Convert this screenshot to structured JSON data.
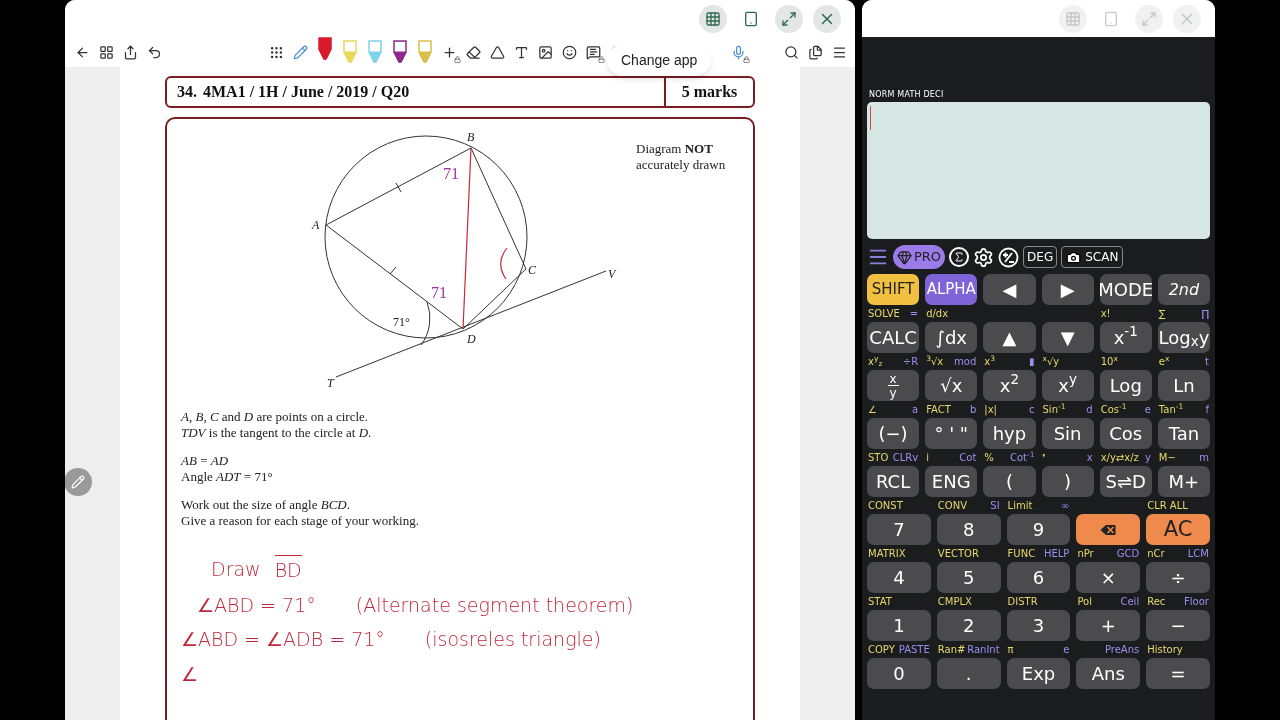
{
  "left_window": {
    "active": true,
    "toolbar": [
      {
        "kind": "back"
      },
      {
        "kind": "grid"
      },
      {
        "kind": "share"
      },
      {
        "kind": "undo"
      },
      {
        "kind": "spacer"
      },
      {
        "kind": "apps"
      },
      {
        "kind": "pencil"
      },
      {
        "kind": "pen",
        "color": "#d81b2b",
        "selected": true
      },
      {
        "kind": "pen",
        "color": "#e8d85a",
        "selected": false
      },
      {
        "kind": "pen",
        "color": "#7fd3e6",
        "selected": false
      },
      {
        "kind": "pen",
        "color": "#8a2a8c",
        "selected": false
      },
      {
        "kind": "pen",
        "color": "#d9c04a",
        "selected": false
      },
      {
        "kind": "add",
        "locked": true
      },
      {
        "kind": "eraser"
      },
      {
        "kind": "lasso"
      },
      {
        "kind": "text"
      },
      {
        "kind": "image"
      },
      {
        "kind": "sticker"
      },
      {
        "kind": "comment",
        "locked": true
      },
      {
        "kind": "bubble"
      },
      {
        "kind": "spacer"
      },
      {
        "kind": "mic",
        "locked": true
      },
      {
        "kind": "gap"
      },
      {
        "kind": "search"
      },
      {
        "kind": "pages"
      },
      {
        "kind": "menu"
      }
    ],
    "tooltip": "Change app",
    "question": {
      "number": "34.",
      "code": "4MA1 / 1H / June / 2019 / Q20",
      "marks": "5 marks",
      "diagram": {
        "note": [
          "Diagram **NOT**",
          "accurately drawn"
        ],
        "points": [
          "A",
          "B",
          "C",
          "D",
          "T",
          "V"
        ],
        "angle": "71°",
        "annotations": [
          "71",
          "71"
        ]
      },
      "text_groups": [
        [
          "*A*, *B*, *C* and *D* are points on a circle.",
          "*TDV* is the tangent to the circle at *D*."
        ],
        [
          "*AB* = *AD*",
          "Angle *ADT* = 71°"
        ],
        [
          "Work out the size of angle *BCD*.",
          "Give a reason for each stage of your working."
        ]
      ],
      "working": [
        {
          "kind": "construct",
          "text": "Draw",
          "segment": "BD"
        },
        {
          "kind": "step",
          "statement": "∠ABD = 71°",
          "reason": "(Alternate segment theorem)"
        },
        {
          "kind": "step",
          "statement": "∠ABD = ∠ADB = 71°",
          "reason": "(isosreles triangle)"
        },
        {
          "kind": "partial",
          "statement": "∠"
        }
      ]
    }
  },
  "right_window": {
    "active": false,
    "status": "NORM MATH DECI",
    "toolbar": [
      {
        "kind": "menu"
      },
      {
        "kind": "pro",
        "label": "PRO"
      },
      {
        "kind": "sum"
      },
      {
        "kind": "settings"
      },
      {
        "kind": "sign"
      },
      {
        "kind": "box",
        "label": "DEG"
      },
      {
        "kind": "scan",
        "label": "SCAN"
      }
    ],
    "rows": [
      [
        {
          "label": "SHIFT",
          "kind": "shift"
        },
        {
          "label": "ALPHA",
          "kind": "alpha"
        },
        {
          "label": "◀",
          "kind": "plain"
        },
        {
          "label": "▶",
          "kind": "plain"
        },
        {
          "label": "MODE",
          "kind": "plain"
        },
        {
          "label": "2nd",
          "kind": "italic"
        }
      ],
      [
        {
          "label": "CALC",
          "kind": "plain",
          "shift": "SOLVE",
          "alpha": "="
        },
        {
          "label": "∫dx",
          "kind": "plain",
          "shift": "d/dx"
        },
        {
          "label": "▲",
          "kind": "plain"
        },
        {
          "label": "▼",
          "kind": "plain"
        },
        {
          "label": "x$^{-1}$",
          "kind": "plain",
          "shift": "x!"
        },
        {
          "label": "Log$_{x}$y",
          "kind": "plain",
          "shift": "∑",
          "alpha": "∏"
        }
      ],
      [
        {
          "kind": "fraction",
          "num": "x",
          "den": "y",
          "shift": "x$^{y}$$_{z}$",
          "alpha": "÷R"
        },
        {
          "label": "√x",
          "kind": "plain",
          "shift": "$^{3}$√x",
          "alpha": "mod"
        },
        {
          "label": "x$^{2}$",
          "kind": "plain",
          "shift": "x$^{3}$",
          "alpha": "▮"
        },
        {
          "label": "x$^{y}$",
          "kind": "plain",
          "shift": "$^{x}$√y"
        },
        {
          "label": "Log",
          "kind": "plain",
          "shift": "10$^{x}$"
        },
        {
          "label": "Ln",
          "kind": "plain",
          "shift": "e$^{x}$",
          "alpha": "t"
        }
      ],
      [
        {
          "label": "(−)",
          "kind": "plain",
          "shift": "∠",
          "alpha": "a"
        },
        {
          "label": "° ' \"",
          "kind": "plain",
          "shift": "FACT",
          "alpha": "b"
        },
        {
          "label": "hyp",
          "kind": "plain",
          "shift": "|x|",
          "alpha": "c"
        },
        {
          "label": "Sin",
          "kind": "plain",
          "shift": "Sin$^{-1}$",
          "alpha": "d"
        },
        {
          "label": "Cos",
          "kind": "plain",
          "shift": "Cos$^{-1}$",
          "alpha": "e"
        },
        {
          "label": "Tan",
          "kind": "plain",
          "shift": "Tan$^{-1}$",
          "alpha": "f"
        }
      ],
      [
        {
          "label": "RCL",
          "kind": "plain",
          "shift": "STO",
          "alpha": "CLRv"
        },
        {
          "label": "ENG",
          "kind": "plain",
          "shift": "i",
          "alpha": "Cot"
        },
        {
          "label": "(",
          "kind": "plain",
          "shift": "%",
          "alpha": "Cot$^{-1}$"
        },
        {
          "label": ")",
          "kind": "plain",
          "shift": "❜",
          "alpha": "x"
        },
        {
          "label": "S⇌D",
          "kind": "plain",
          "shift": "x/y⇄x/z",
          "alpha": "y"
        },
        {
          "label": "M+",
          "kind": "plain",
          "shift": "M−",
          "alpha": "m"
        }
      ],
      [
        {
          "label": "7",
          "kind": "plain",
          "shift": "CONST"
        },
        {
          "label": "8",
          "kind": "plain",
          "shift": "CONV",
          "alpha": "SI"
        },
        {
          "label": "9",
          "kind": "plain",
          "shift": "Limit",
          "alpha": "∞"
        },
        {
          "kind": "delete"
        },
        {
          "label": "AC",
          "kind": "orange",
          "shift": "CLR ALL"
        }
      ],
      [
        {
          "label": "4",
          "kind": "plain",
          "shift": "MATRIX"
        },
        {
          "label": "5",
          "kind": "plain",
          "shift": "VECTOR"
        },
        {
          "label": "6",
          "kind": "plain",
          "shift": "FUNC",
          "alpha": "HELP"
        },
        {
          "label": "×",
          "kind": "plain",
          "shift": "nPr",
          "alpha": "GCD"
        },
        {
          "label": "÷",
          "kind": "plain",
          "shift": "nCr",
          "alpha": "LCM"
        }
      ],
      [
        {
          "label": "1",
          "kind": "plain",
          "shift": "STAT"
        },
        {
          "label": "2",
          "kind": "plain",
          "shift": "CMPLX"
        },
        {
          "label": "3",
          "kind": "plain",
          "shift": "DISTR"
        },
        {
          "label": "+",
          "kind": "plain",
          "shift": "Pol",
          "alpha": "Ceil"
        },
        {
          "label": "−",
          "kind": "plain",
          "shift": "Rec",
          "alpha": "Floor"
        }
      ],
      [
        {
          "label": "0",
          "kind": "plain",
          "shift": "COPY",
          "alpha": "PASTE"
        },
        {
          "label": ".",
          "kind": "plain",
          "shift": "Ran#",
          "alpha": "RanInt"
        },
        {
          "label": "Exp",
          "kind": "plain",
          "shift": "π",
          "alpha": "e"
        },
        {
          "label": "Ans",
          "kind": "plain",
          "alpha": "PreAns"
        },
        {
          "label": "=",
          "kind": "plain",
          "shift": "History"
        }
      ]
    ]
  }
}
